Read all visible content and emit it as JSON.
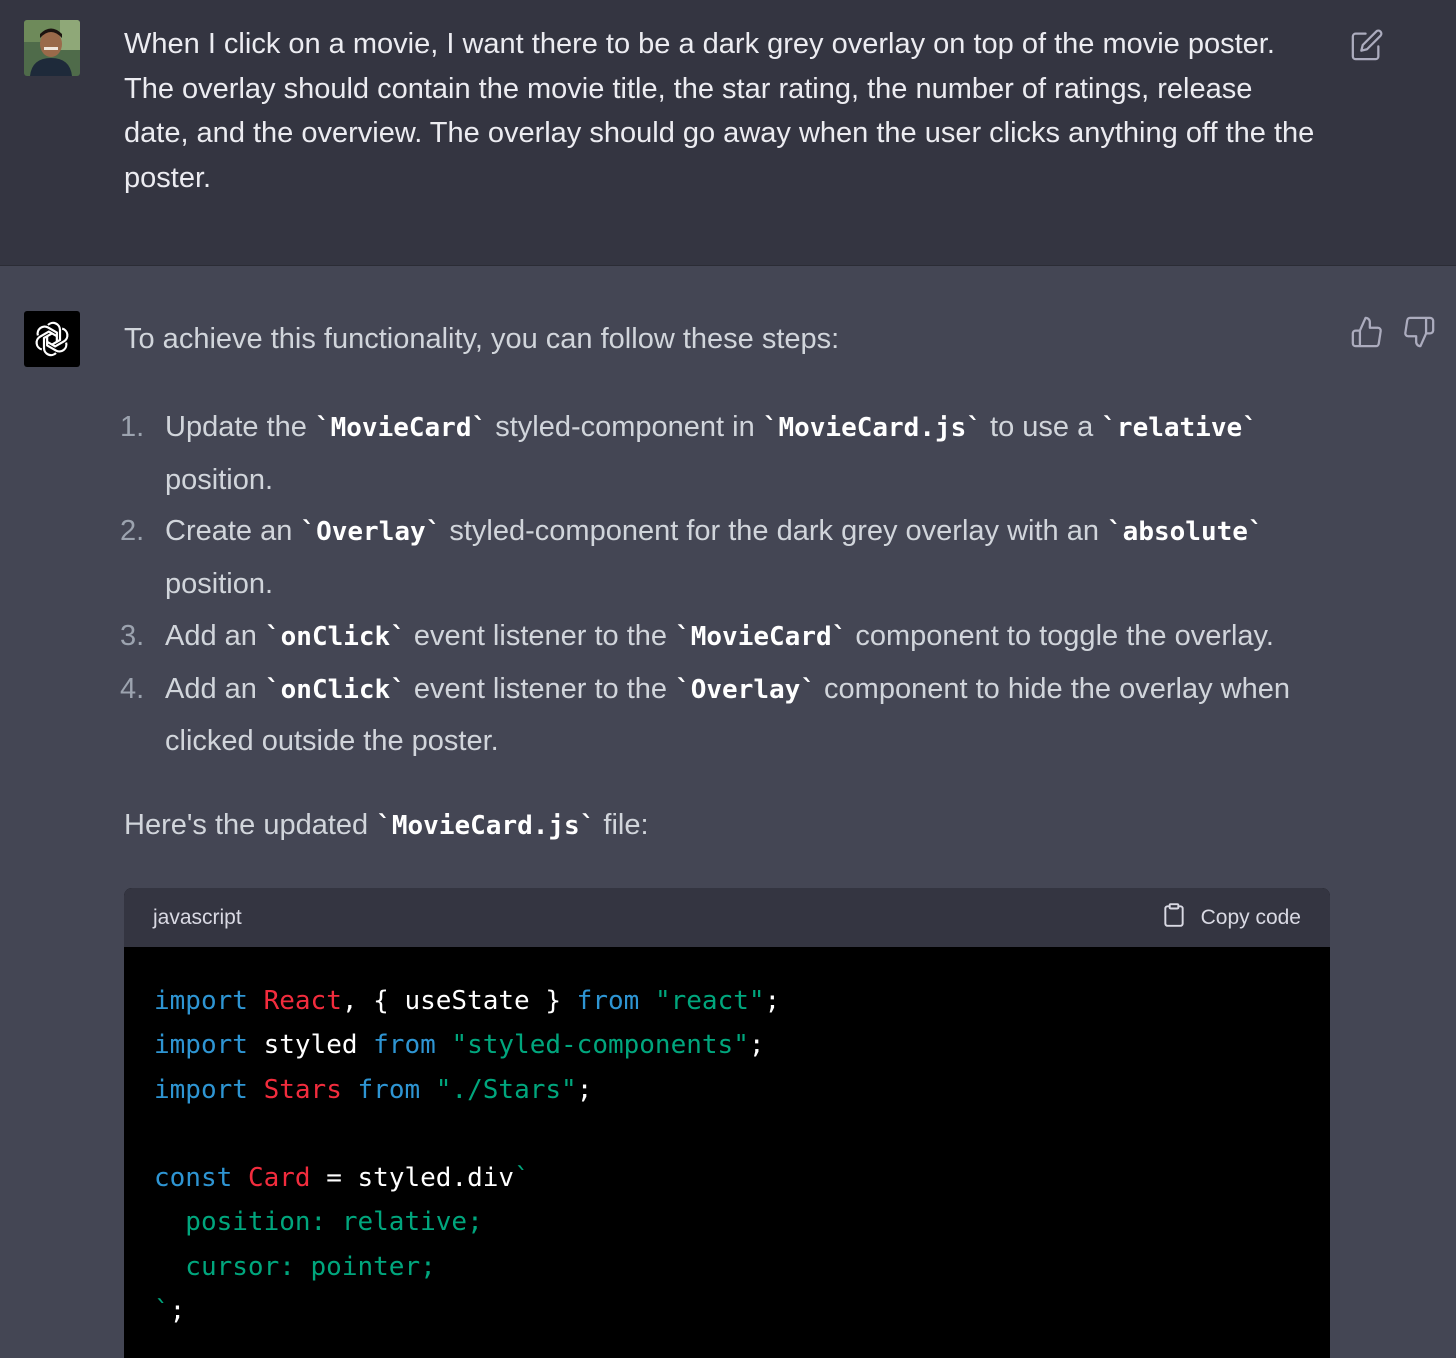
{
  "user_message": {
    "text": "When I click on a movie, I want there to be a dark grey overlay on top of the movie poster. The overlay should contain the movie title, the star rating, the number of ratings, release date, and the overview. The overlay should go away when the user clicks anything off the the poster."
  },
  "assistant_message": {
    "intro": "To achieve this functionality, you can follow these steps:",
    "steps": [
      {
        "num": "1.",
        "t1": "Update the ",
        "c1": "`MovieCard`",
        "t2": " styled-component in ",
        "c2": "`MovieCard.js`",
        "t3": " to use a ",
        "c3": "`relative`",
        "t4": " position."
      },
      {
        "num": "2.",
        "t1": "Create an ",
        "c1": "`Overlay`",
        "t2": " styled-component for the dark grey overlay with an ",
        "c2": "`absolute`",
        "t3": " position."
      },
      {
        "num": "3.",
        "t1": "Add an ",
        "c1": "`onClick`",
        "t2": " event listener to the ",
        "c2": "`MovieCard`",
        "t3": " component to toggle the overlay."
      },
      {
        "num": "4.",
        "t1": "Add an ",
        "c1": "`onClick`",
        "t2": " event listener to the ",
        "c2": "`Overlay`",
        "t3": " component to hide the overlay when clicked outside the poster."
      }
    ],
    "updated_prefix": "Here's the updated ",
    "updated_code": "`MovieCard.js`",
    "updated_suffix": " file:"
  },
  "code_block": {
    "language": "javascript",
    "copy_label": "Copy code",
    "tokens": {
      "import": "import",
      "from": "from",
      "const": "const",
      "react_ident": "React",
      "react_brace": ", { useState } ",
      "react_str": "\"react\"",
      "styled_ident": " styled ",
      "styled_str": "\"styled-components\"",
      "stars_ident": "Stars",
      "stars_str": "\"./Stars\"",
      "semi": ";",
      "card_ident": "Card",
      "card_assign": " = styled.div",
      "backtick": "`",
      "line_pos": "  position: relative;",
      "line_cursor": "  cursor: pointer;",
      "close_semi": ";"
    }
  },
  "icons": {
    "edit": "edit-icon",
    "thumbs_up": "thumbs-up-icon",
    "thumbs_down": "thumbs-down-icon",
    "clipboard": "clipboard-icon",
    "assistant_logo": "openai-logo-icon",
    "user_avatar": "user-avatar"
  },
  "colors": {
    "user_bg": "#343541",
    "assistant_bg": "#444654",
    "code_bg": "#000000",
    "keyword": "#2e95d3",
    "class_name": "#f22c3d",
    "string": "#00a67d"
  }
}
